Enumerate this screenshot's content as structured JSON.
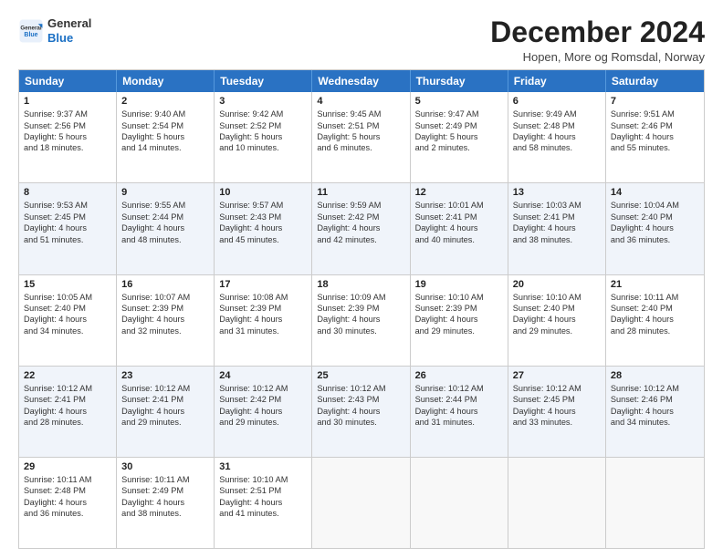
{
  "header": {
    "logo_general": "General",
    "logo_blue": "Blue",
    "title": "December 2024",
    "location": "Hopen, More og Romsdal, Norway"
  },
  "weekdays": [
    "Sunday",
    "Monday",
    "Tuesday",
    "Wednesday",
    "Thursday",
    "Friday",
    "Saturday"
  ],
  "rows": [
    [
      {
        "day": "1",
        "lines": [
          "Sunrise: 9:37 AM",
          "Sunset: 2:56 PM",
          "Daylight: 5 hours",
          "and 18 minutes."
        ]
      },
      {
        "day": "2",
        "lines": [
          "Sunrise: 9:40 AM",
          "Sunset: 2:54 PM",
          "Daylight: 5 hours",
          "and 14 minutes."
        ]
      },
      {
        "day": "3",
        "lines": [
          "Sunrise: 9:42 AM",
          "Sunset: 2:52 PM",
          "Daylight: 5 hours",
          "and 10 minutes."
        ]
      },
      {
        "day": "4",
        "lines": [
          "Sunrise: 9:45 AM",
          "Sunset: 2:51 PM",
          "Daylight: 5 hours",
          "and 6 minutes."
        ]
      },
      {
        "day": "5",
        "lines": [
          "Sunrise: 9:47 AM",
          "Sunset: 2:49 PM",
          "Daylight: 5 hours",
          "and 2 minutes."
        ]
      },
      {
        "day": "6",
        "lines": [
          "Sunrise: 9:49 AM",
          "Sunset: 2:48 PM",
          "Daylight: 4 hours",
          "and 58 minutes."
        ]
      },
      {
        "day": "7",
        "lines": [
          "Sunrise: 9:51 AM",
          "Sunset: 2:46 PM",
          "Daylight: 4 hours",
          "and 55 minutes."
        ]
      }
    ],
    [
      {
        "day": "8",
        "lines": [
          "Sunrise: 9:53 AM",
          "Sunset: 2:45 PM",
          "Daylight: 4 hours",
          "and 51 minutes."
        ]
      },
      {
        "day": "9",
        "lines": [
          "Sunrise: 9:55 AM",
          "Sunset: 2:44 PM",
          "Daylight: 4 hours",
          "and 48 minutes."
        ]
      },
      {
        "day": "10",
        "lines": [
          "Sunrise: 9:57 AM",
          "Sunset: 2:43 PM",
          "Daylight: 4 hours",
          "and 45 minutes."
        ]
      },
      {
        "day": "11",
        "lines": [
          "Sunrise: 9:59 AM",
          "Sunset: 2:42 PM",
          "Daylight: 4 hours",
          "and 42 minutes."
        ]
      },
      {
        "day": "12",
        "lines": [
          "Sunrise: 10:01 AM",
          "Sunset: 2:41 PM",
          "Daylight: 4 hours",
          "and 40 minutes."
        ]
      },
      {
        "day": "13",
        "lines": [
          "Sunrise: 10:03 AM",
          "Sunset: 2:41 PM",
          "Daylight: 4 hours",
          "and 38 minutes."
        ]
      },
      {
        "day": "14",
        "lines": [
          "Sunrise: 10:04 AM",
          "Sunset: 2:40 PM",
          "Daylight: 4 hours",
          "and 36 minutes."
        ]
      }
    ],
    [
      {
        "day": "15",
        "lines": [
          "Sunrise: 10:05 AM",
          "Sunset: 2:40 PM",
          "Daylight: 4 hours",
          "and 34 minutes."
        ]
      },
      {
        "day": "16",
        "lines": [
          "Sunrise: 10:07 AM",
          "Sunset: 2:39 PM",
          "Daylight: 4 hours",
          "and 32 minutes."
        ]
      },
      {
        "day": "17",
        "lines": [
          "Sunrise: 10:08 AM",
          "Sunset: 2:39 PM",
          "Daylight: 4 hours",
          "and 31 minutes."
        ]
      },
      {
        "day": "18",
        "lines": [
          "Sunrise: 10:09 AM",
          "Sunset: 2:39 PM",
          "Daylight: 4 hours",
          "and 30 minutes."
        ]
      },
      {
        "day": "19",
        "lines": [
          "Sunrise: 10:10 AM",
          "Sunset: 2:39 PM",
          "Daylight: 4 hours",
          "and 29 minutes."
        ]
      },
      {
        "day": "20",
        "lines": [
          "Sunrise: 10:10 AM",
          "Sunset: 2:40 PM",
          "Daylight: 4 hours",
          "and 29 minutes."
        ]
      },
      {
        "day": "21",
        "lines": [
          "Sunrise: 10:11 AM",
          "Sunset: 2:40 PM",
          "Daylight: 4 hours",
          "and 28 minutes."
        ]
      }
    ],
    [
      {
        "day": "22",
        "lines": [
          "Sunrise: 10:12 AM",
          "Sunset: 2:41 PM",
          "Daylight: 4 hours",
          "and 28 minutes."
        ]
      },
      {
        "day": "23",
        "lines": [
          "Sunrise: 10:12 AM",
          "Sunset: 2:41 PM",
          "Daylight: 4 hours",
          "and 29 minutes."
        ]
      },
      {
        "day": "24",
        "lines": [
          "Sunrise: 10:12 AM",
          "Sunset: 2:42 PM",
          "Daylight: 4 hours",
          "and 29 minutes."
        ]
      },
      {
        "day": "25",
        "lines": [
          "Sunrise: 10:12 AM",
          "Sunset: 2:43 PM",
          "Daylight: 4 hours",
          "and 30 minutes."
        ]
      },
      {
        "day": "26",
        "lines": [
          "Sunrise: 10:12 AM",
          "Sunset: 2:44 PM",
          "Daylight: 4 hours",
          "and 31 minutes."
        ]
      },
      {
        "day": "27",
        "lines": [
          "Sunrise: 10:12 AM",
          "Sunset: 2:45 PM",
          "Daylight: 4 hours",
          "and 33 minutes."
        ]
      },
      {
        "day": "28",
        "lines": [
          "Sunrise: 10:12 AM",
          "Sunset: 2:46 PM",
          "Daylight: 4 hours",
          "and 34 minutes."
        ]
      }
    ],
    [
      {
        "day": "29",
        "lines": [
          "Sunrise: 10:11 AM",
          "Sunset: 2:48 PM",
          "Daylight: 4 hours",
          "and 36 minutes."
        ]
      },
      {
        "day": "30",
        "lines": [
          "Sunrise: 10:11 AM",
          "Sunset: 2:49 PM",
          "Daylight: 4 hours",
          "and 38 minutes."
        ]
      },
      {
        "day": "31",
        "lines": [
          "Sunrise: 10:10 AM",
          "Sunset: 2:51 PM",
          "Daylight: 4 hours",
          "and 41 minutes."
        ]
      },
      {
        "day": "",
        "lines": []
      },
      {
        "day": "",
        "lines": []
      },
      {
        "day": "",
        "lines": []
      },
      {
        "day": "",
        "lines": []
      }
    ]
  ]
}
